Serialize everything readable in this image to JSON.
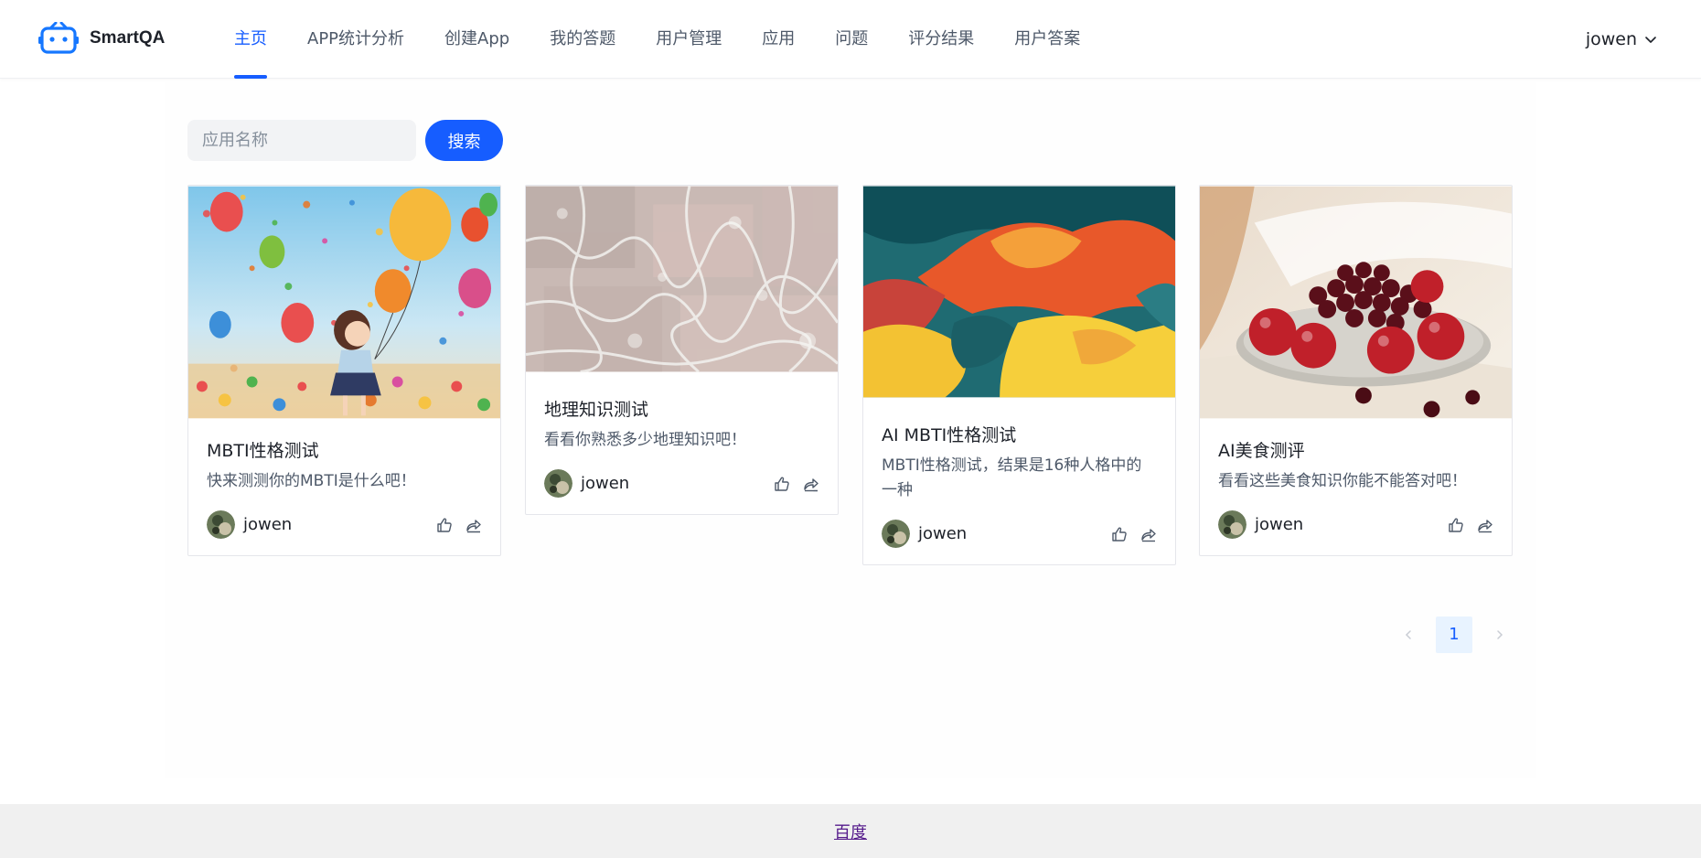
{
  "header": {
    "app_name": "SmartQA",
    "logo_icon": "robot-logo-icon",
    "nav": [
      {
        "label": "主页",
        "active": true
      },
      {
        "label": "APP统计分析",
        "active": false
      },
      {
        "label": "创建App",
        "active": false
      },
      {
        "label": "我的答题",
        "active": false
      },
      {
        "label": "用户管理",
        "active": false
      },
      {
        "label": "应用",
        "active": false
      },
      {
        "label": "问题",
        "active": false
      },
      {
        "label": "评分结果",
        "active": false
      },
      {
        "label": "用户答案",
        "active": false
      }
    ],
    "user": {
      "name": "jowen",
      "icon": "chevron-down-icon"
    }
  },
  "search": {
    "placeholder": "应用名称",
    "value": "",
    "button_label": "搜索"
  },
  "cards": [
    {
      "title": "MBTI性格测试",
      "description": "快来测测你的MBTI是什么吧！",
      "author": "jowen",
      "cover": "balloons-girl-illustration"
    },
    {
      "title": "地理知识测试",
      "description": "看看你熟悉多少地理知识吧！",
      "author": "jowen",
      "cover": "sea-foam-texture"
    },
    {
      "title": "AI MBTI性格测试",
      "description": "MBTI性格测试，结果是16种人格中的一种",
      "author": "jowen",
      "cover": "abstract-color-painting"
    },
    {
      "title": "AI美食测评",
      "description": "看看这些美食知识你能不能答对吧！",
      "author": "jowen",
      "cover": "cherries-plate-photo"
    }
  ],
  "pagination": {
    "current_page": "1"
  },
  "footer": {
    "link_label": "百度"
  },
  "colors": {
    "primary": "#165dff",
    "text": "#1d2129",
    "secondary_text": "#4e5969",
    "border": "#e5e6eb"
  }
}
